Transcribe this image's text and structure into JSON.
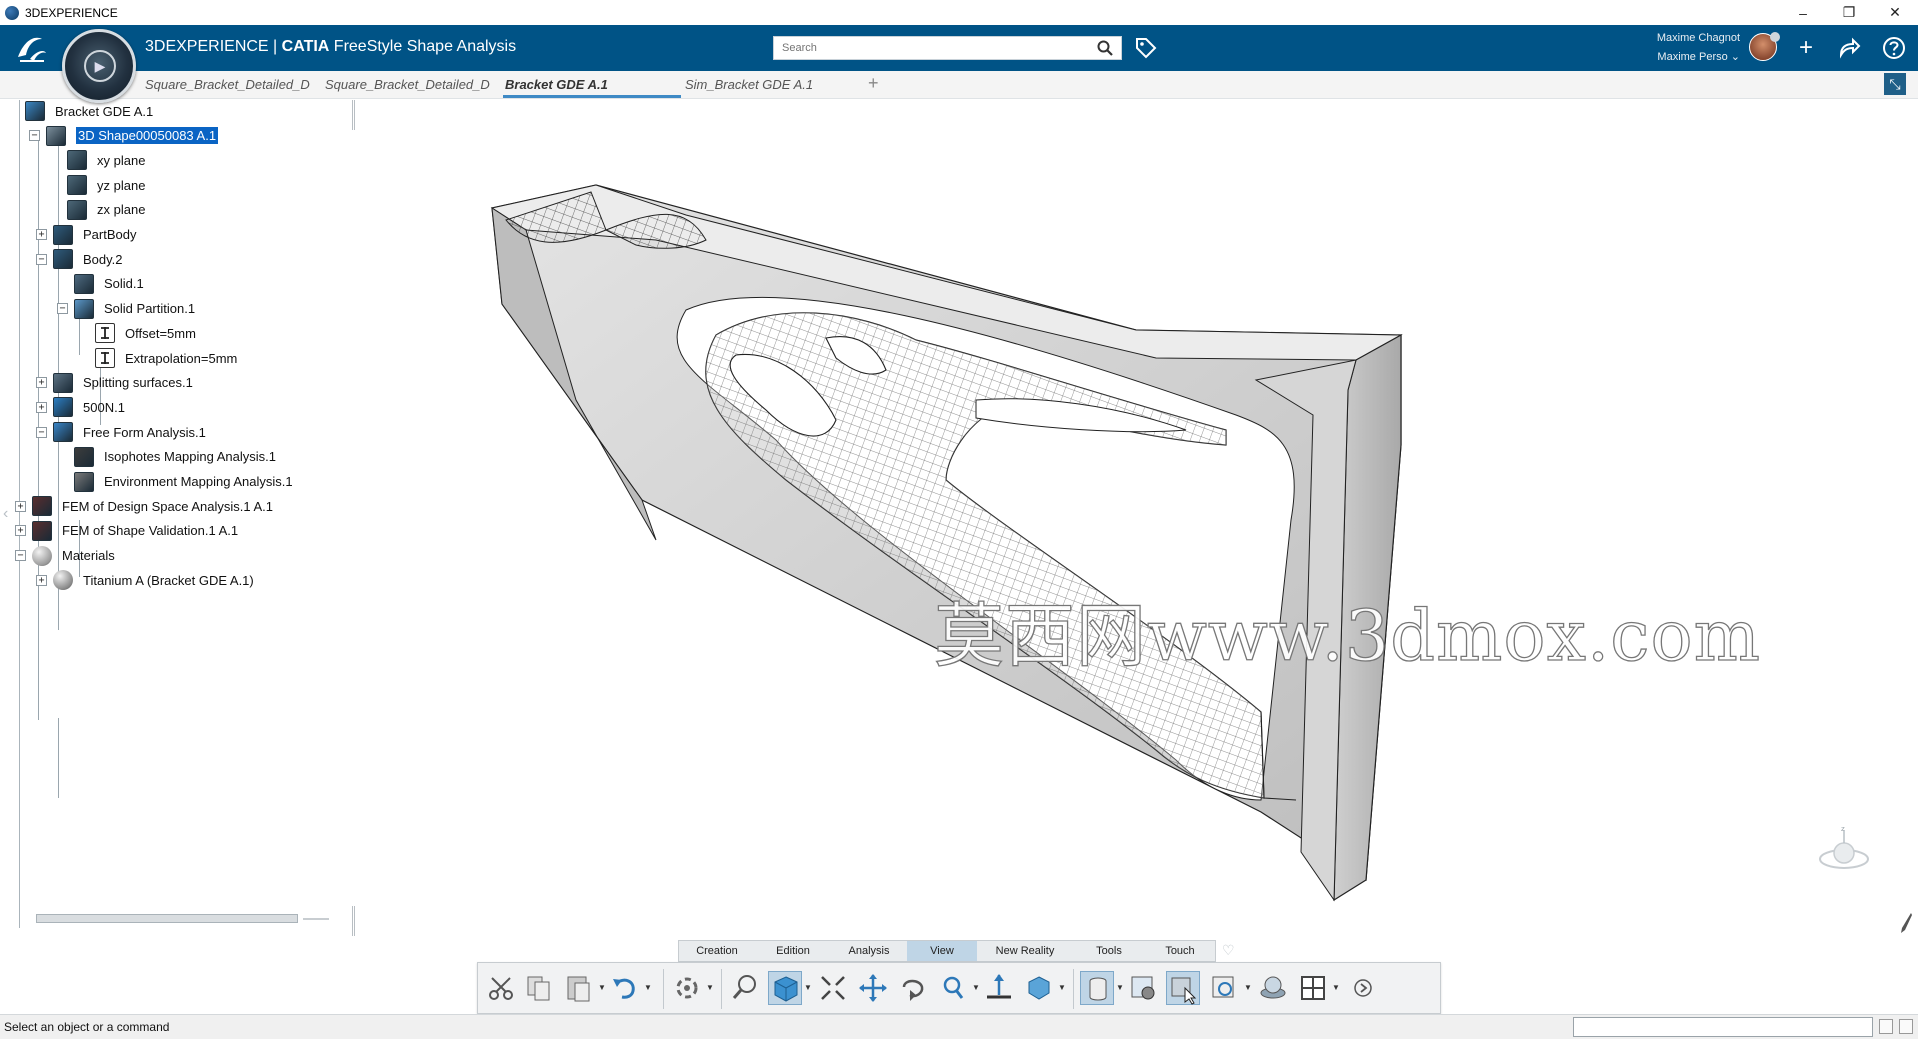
{
  "window": {
    "title": "3DEXPERIENCE",
    "controls": {
      "minimize": "–",
      "restore": "❐",
      "close": "✕"
    }
  },
  "appbar": {
    "brand_prefix": "3DEXPERIENCE | ",
    "brand_app": "CATIA",
    "brand_suffix": " FreeStyle Shape Analysis",
    "search_placeholder": "Search",
    "user_name": "Maxime Chagnot",
    "user_context": "Maxime Perso"
  },
  "tabs": [
    {
      "label": "Square_Bracket_Detailed_D",
      "active": false
    },
    {
      "label": "Square_Bracket_Detailed_D",
      "active": false
    },
    {
      "label": "Bracket GDE A.1",
      "active": true
    },
    {
      "label": "Sim_Bracket GDE A.1",
      "active": false
    }
  ],
  "tabs_add": "+",
  "tree": {
    "nodes": [
      {
        "label": "Bracket GDE A.1",
        "icon": "product-icon",
        "pm": ""
      },
      {
        "label": "3D Shape00050083 A.1",
        "icon": "3dshape-icon",
        "pm": "−",
        "selected": true
      },
      {
        "label": "xy plane",
        "icon": "plane-icon",
        "pm": ""
      },
      {
        "label": "yz plane",
        "icon": "plane-icon",
        "pm": ""
      },
      {
        "label": "zx plane",
        "icon": "plane-icon",
        "pm": ""
      },
      {
        "label": "PartBody",
        "icon": "body-icon",
        "pm": "+"
      },
      {
        "label": "Body.2",
        "icon": "body-icon",
        "pm": "−"
      },
      {
        "label": "Solid.1",
        "icon": "solid-icon",
        "pm": ""
      },
      {
        "label": "Solid Partition.1",
        "icon": "partition-icon",
        "pm": "−"
      },
      {
        "label": "Offset=5mm",
        "icon": "parameter-icon",
        "pm": ""
      },
      {
        "label": "Extrapolation=5mm",
        "icon": "parameter-icon",
        "pm": ""
      },
      {
        "label": "Splitting surfaces.1",
        "icon": "surfaces-icon",
        "pm": "+"
      },
      {
        "label": "500N.1",
        "icon": "load-icon",
        "pm": "+"
      },
      {
        "label": "Free Form Analysis.1",
        "icon": "analysis-icon",
        "pm": "−"
      },
      {
        "label": "Isophotes Mapping Analysis.1",
        "icon": "isophotes-icon",
        "pm": ""
      },
      {
        "label": "Environment Mapping Analysis.1",
        "icon": "environment-icon",
        "pm": ""
      },
      {
        "label": "FEM of Design Space Analysis.1 A.1",
        "icon": "fem-icon",
        "pm": "+"
      },
      {
        "label": "FEM of Shape Validation.1 A.1",
        "icon": "fem-icon",
        "pm": "+"
      },
      {
        "label": "Materials",
        "icon": "materials-icon",
        "pm": "−"
      },
      {
        "label": "Titanium A (Bracket GDE A.1)",
        "icon": "material-sphere-icon",
        "pm": "+"
      }
    ]
  },
  "viewport": {
    "watermark": "莫西网www.3dmox.com",
    "model": "bracket-3d-model"
  },
  "section_tabs": [
    {
      "label": "Creation",
      "active": false
    },
    {
      "label": "Edition",
      "active": false
    },
    {
      "label": "Analysis",
      "active": false
    },
    {
      "label": "View",
      "active": true
    },
    {
      "label": "New Reality",
      "active": false
    },
    {
      "label": "Tools",
      "active": false
    },
    {
      "label": "Touch",
      "active": false
    }
  ],
  "action_bar": [
    "cut-icon",
    "copy-icon",
    "paste-icon",
    "undo-icon",
    "update-icon",
    "zoom-area-icon",
    "view-mode-icon",
    "fit-all-icon",
    "pan-icon",
    "rotate-icon",
    "zoom-icon",
    "normal-view-icon",
    "views-icon",
    "cylinder-icon",
    "render-settings-icon",
    "select-mode-icon",
    "refresh-icon",
    "ambience-icon",
    "layout-icon",
    "more-icon"
  ],
  "status": {
    "message": "Select an object or a command"
  },
  "colors": {
    "appbar": "#005386",
    "accent": "#3f8ac5",
    "selection": "#0a64c4",
    "section_active": "#bfd5e6"
  }
}
